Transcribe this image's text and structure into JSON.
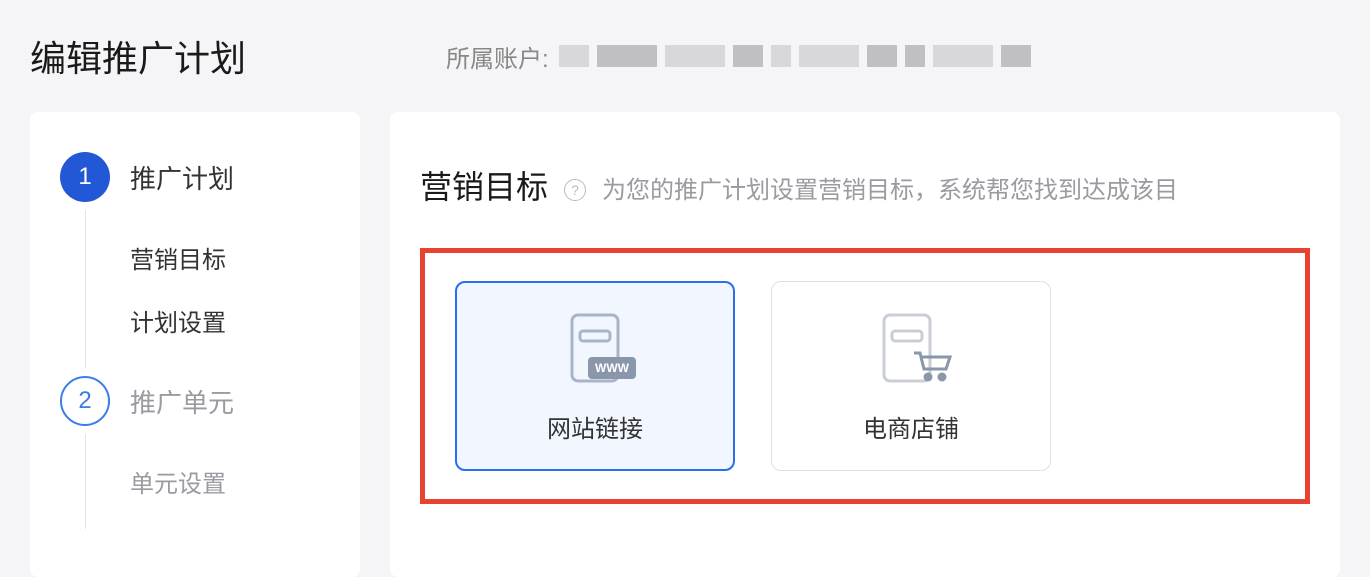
{
  "header": {
    "page_title": "编辑推广计划",
    "account_label": "所属账户:"
  },
  "sidebar": {
    "steps": [
      {
        "number": "1",
        "label": "推广计划",
        "active": true,
        "substeps": [
          "营销目标",
          "计划设置"
        ]
      },
      {
        "number": "2",
        "label": "推广单元",
        "active": false,
        "substeps": [
          "单元设置"
        ]
      }
    ]
  },
  "main": {
    "section_title": "营销目标",
    "section_desc": "为您的推广计划设置营销目标，系统帮您找到达成该目",
    "options": [
      {
        "label": "网站链接",
        "icon": "website-link",
        "selected": true
      },
      {
        "label": "电商店铺",
        "icon": "ecommerce-store",
        "selected": false
      }
    ]
  }
}
